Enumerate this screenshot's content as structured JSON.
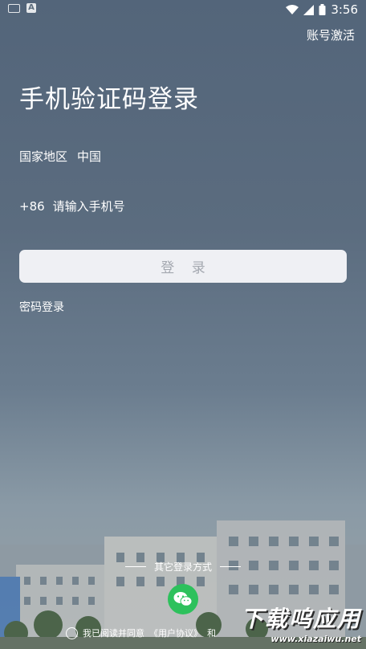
{
  "status_bar": {
    "time": "3:56",
    "left_icons": [
      "keyboard-icon",
      "a-icon"
    ],
    "right_icons": [
      "wifi-icon",
      "signal-icon",
      "battery-icon"
    ]
  },
  "header": {
    "activate_label": "账号激活"
  },
  "main": {
    "title": "手机验证码登录",
    "region": {
      "label": "国家地区",
      "value": "中国"
    },
    "phone": {
      "code": "+86",
      "placeholder": "请输入手机号"
    },
    "login_label": "登 录",
    "password_login_label": "密码登录"
  },
  "footer": {
    "other_login_label": "其它登录方式",
    "agreement_prefix": "我已阅读并同意",
    "agreement_link": "《用户协议》",
    "agreement_and": "和"
  },
  "watermark": {
    "brand": "下载呜应用",
    "url": "www.xiazaiwu.net"
  },
  "colors": {
    "wechat": "#2dc15c",
    "login_bg": "#eff0f4",
    "login_text": "#a4a8b0"
  }
}
